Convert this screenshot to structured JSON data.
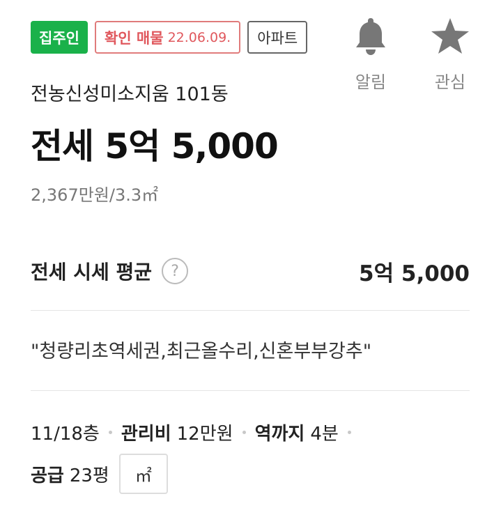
{
  "badges": {
    "owner": "집주인",
    "verified_label": "확인 매물",
    "verified_date": "22.06.09.",
    "property_type": "아파트"
  },
  "actions": {
    "alarm": "알림",
    "favorite": "관심"
  },
  "listing": {
    "complex_name": "전농신성미소지움 101동",
    "price": "전세 5억 5,000",
    "unit_price": "2,367만원/3.3㎡"
  },
  "market": {
    "label": "전세 시세 평균",
    "help": "?",
    "value": "5억 5,000"
  },
  "description": "\"청량리초역세권,최근올수리,신혼부부강추\"",
  "specs": {
    "floor": "11/18층",
    "maintenance_key": "관리비",
    "maintenance_value": "12만원",
    "station_key": "역까지",
    "station_value": "4분",
    "supply_key": "공급",
    "supply_value": "23평",
    "unit_toggle": "㎡"
  },
  "colors": {
    "owner_badge": "#1ab14a",
    "verified_badge": "#e0585d",
    "icon_gray": "#777777"
  }
}
